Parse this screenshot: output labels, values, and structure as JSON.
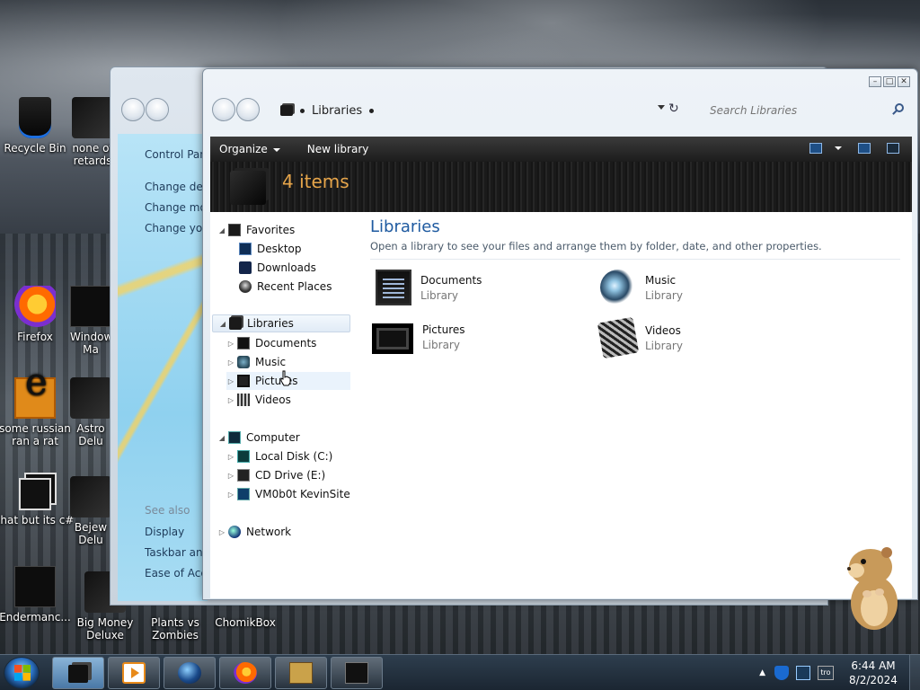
{
  "desktop": {
    "icons": [
      {
        "label": "Recycle Bin",
        "icon": "recycle-bin-icon"
      },
      {
        "label": "none of\nretards",
        "icon": "folder-icon"
      },
      {
        "label": "Firefox",
        "icon": "firefox-icon"
      },
      {
        "label": "Windows\nMa",
        "icon": "app-icon"
      },
      {
        "label": "some russian\nran a rat",
        "icon": "ie-icon"
      },
      {
        "label": "Astro\nDelu",
        "icon": "game-icon"
      },
      {
        "label": "that but its c#",
        "icon": "shortcut-icon"
      },
      {
        "label": "Bejew\nDelu",
        "icon": "game-icon"
      },
      {
        "label": "Endermanc...",
        "icon": "app-icon"
      },
      {
        "label": "Big Money\nDeluxe",
        "icon": "game-icon"
      },
      {
        "label": "Plants vs\nZombies",
        "icon": "game-icon"
      },
      {
        "label": "ChomikBox",
        "icon": "app-icon"
      }
    ]
  },
  "back_window": {
    "sidebar": {
      "home": "Control Pan",
      "links": [
        "Change desk",
        "Change mo",
        "Change you"
      ],
      "see_also_title": "See also",
      "see_also": [
        "Display",
        "Taskbar and",
        "Ease of Acce"
      ]
    }
  },
  "window": {
    "address": {
      "crumb": "Libraries"
    },
    "search": {
      "placeholder": "Search Libraries"
    },
    "caption": {
      "minimize": "–",
      "maximize": "□",
      "close": "✕"
    },
    "toolbar": {
      "organize": "Organize",
      "new_library": "New library"
    },
    "banner": {
      "count": "4 items"
    },
    "nav": {
      "favorites": {
        "label": "Favorites",
        "items": [
          "Desktop",
          "Downloads",
          "Recent Places"
        ]
      },
      "libraries": {
        "label": "Libraries",
        "items": [
          "Documents",
          "Music",
          "Pictures",
          "Videos"
        ]
      },
      "computer": {
        "label": "Computer",
        "items": [
          "Local Disk (C:)",
          "CD Drive (E:)",
          "VM0b0t KevinSite"
        ]
      },
      "network": {
        "label": "Network"
      }
    },
    "main": {
      "title": "Libraries",
      "subtitle": "Open a library to see your files and arrange them by folder, date, and other properties.",
      "libraries": [
        {
          "name": "Documents",
          "type": "Library",
          "icon": "documents-library-icon"
        },
        {
          "name": "Music",
          "type": "Library",
          "icon": "music-library-icon"
        },
        {
          "name": "Pictures",
          "type": "Library",
          "icon": "pictures-library-icon"
        },
        {
          "name": "Videos",
          "type": "Library",
          "icon": "videos-library-icon"
        }
      ]
    }
  },
  "taskbar": {
    "buttons": [
      {
        "name": "libraries-explorer",
        "icon": "libraries-icon",
        "active": true
      },
      {
        "name": "media-player",
        "icon": "media-player-icon",
        "active": false
      },
      {
        "name": "browser-globe",
        "icon": "globe-icon",
        "active": false
      },
      {
        "name": "firefox",
        "icon": "firefox-icon",
        "active": false
      },
      {
        "name": "chomikbox",
        "icon": "chomikbox-icon",
        "active": false
      },
      {
        "name": "control-panel",
        "icon": "window-icon",
        "active": false
      }
    ],
    "tray": {
      "lang": "tro",
      "time": "6:44 AM",
      "date": "8/2/2024"
    }
  }
}
